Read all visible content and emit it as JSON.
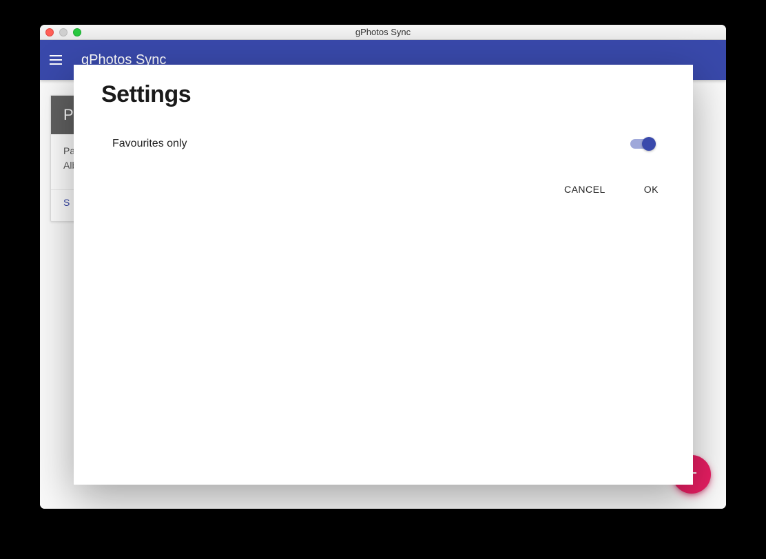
{
  "window": {
    "title": "gPhotos Sync"
  },
  "toolbar": {
    "title": "gPhotos Sync"
  },
  "card": {
    "header": "Pi",
    "body_line1": "Pat",
    "body_line2": "Alb",
    "action": "S"
  },
  "dialog": {
    "title": "Settings",
    "settings": [
      {
        "label": "Favourites only",
        "on": true
      }
    ],
    "cancel": "CANCEL",
    "ok": "OK"
  },
  "colors": {
    "primary": "#3949ab",
    "accent": "#e91e63"
  }
}
